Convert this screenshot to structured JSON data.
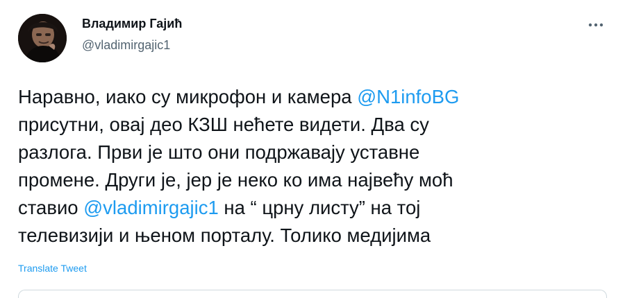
{
  "author": {
    "name": "Владимир Гајић",
    "handle": "@vladimirgajic1"
  },
  "tweet": {
    "lines": [
      {
        "pre": "Наравно, иако су микрофон и камера ",
        "mention": "@N1infoBG",
        "post": ""
      },
      {
        "pre": "присутни, овај део КЗШ нећете видети. Два су",
        "mention": "",
        "post": ""
      },
      {
        "pre": "разлога. Први је што они подржавају уставне",
        "mention": "",
        "post": ""
      },
      {
        "pre": "промене. Други је, јер је неко ко има највећу моћ",
        "mention": "",
        "post": ""
      },
      {
        "pre": "ставио ",
        "mention": "@vladimirgajic1",
        "post": " на “ црну листу” на тој"
      },
      {
        "pre": "телевизији и њеном порталу. Толико медијима",
        "mention": "",
        "post": ""
      }
    ],
    "translate_label": "Translate Tweet"
  },
  "icons": {
    "more": "more-horizontal-icon",
    "avatar": "profile-photo"
  },
  "colors": {
    "link": "#1d9bf0",
    "text": "#0f1419",
    "secondary": "#536471"
  }
}
